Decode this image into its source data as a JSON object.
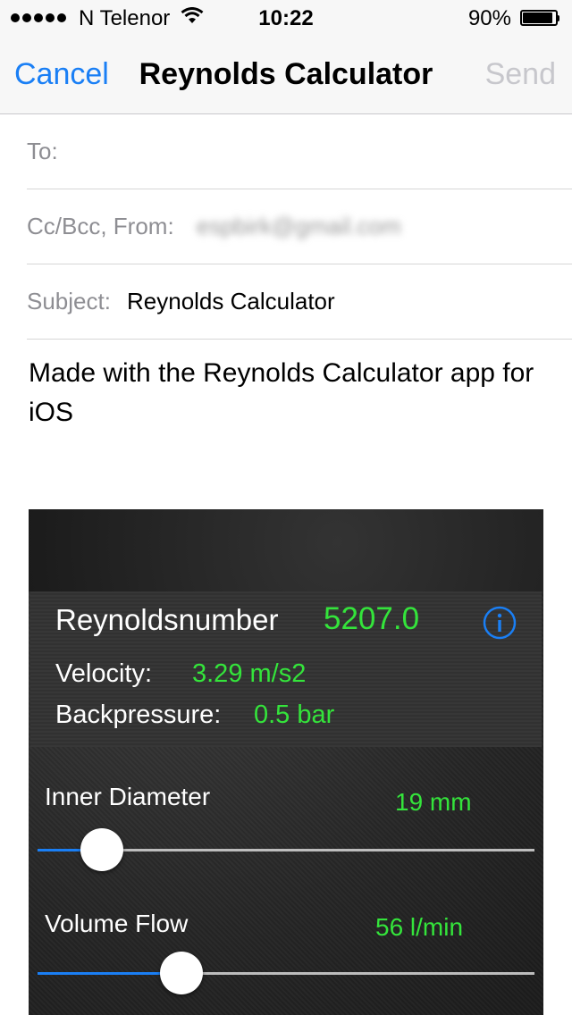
{
  "status_bar": {
    "carrier": "N Telenor",
    "time": "10:22",
    "battery": "90%"
  },
  "nav": {
    "cancel": "Cancel",
    "title": "Reynolds Calculator",
    "send": "Send"
  },
  "fields": {
    "to_label": "To:",
    "to_value": "",
    "cc_label": "Cc/Bcc, From:",
    "cc_value": "espbirk@gmail.com",
    "subject_label": "Subject:",
    "subject_value": "Reynolds Calculator"
  },
  "body": {
    "text": "Made with the Reynolds Calculator app for iOS"
  },
  "attachment": {
    "reynolds_label": "Reynoldsnumber",
    "reynolds_value": "5207.0",
    "velocity_label": "Velocity:",
    "velocity_value": "3.29 m/s2",
    "backpressure_label": "Backpressure:",
    "backpressure_value": "0.5 bar",
    "inner_diameter_label": "Inner Diameter",
    "inner_diameter_value": "19  mm",
    "inner_diameter_slider": 0.13,
    "volume_flow_label": "Volume Flow",
    "volume_flow_value": "56  l/min",
    "volume_flow_slider": 0.29
  },
  "colors": {
    "accent": "#1a7ff5",
    "value_green": "#34e43b",
    "disabled": "#c7c7cc"
  }
}
